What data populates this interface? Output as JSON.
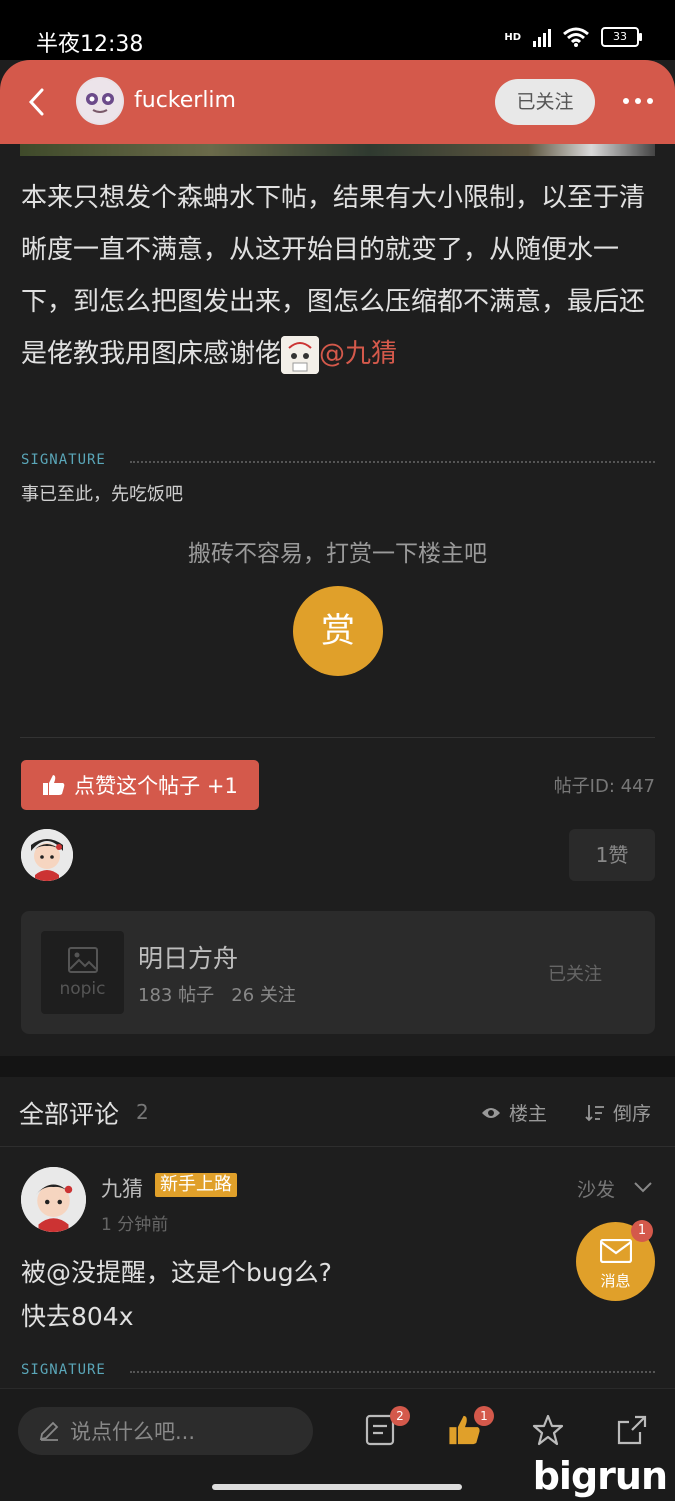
{
  "status_bar": {
    "time": "半夜12:38",
    "network": "HD",
    "battery": "33"
  },
  "header": {
    "username": "fuckerlim",
    "follow_label": "已关注"
  },
  "post": {
    "body_text": "本来只想发个森蚺水下帖，结果有大小限制，以至于清晰度一直不满意，从这开始目的就变了，从随便水一下，到怎么把图发出来，图怎么压缩都不满意，最后还是佬教我用图床感谢佬",
    "mention": "@九猜",
    "signature_label": "SIGNATURE",
    "signature_text": "事已至此，先吃饭吧",
    "tip_prompt": "搬砖不容易，打赏一下楼主吧",
    "tip_button": "赏",
    "like_button": "点赞这个帖子 +1",
    "post_id": "帖子ID: 447",
    "like_count": "1赞"
  },
  "forum": {
    "nopic_label": "nopic",
    "name": "明日方舟",
    "posts": "183 帖子",
    "followers": "26 关注",
    "follow_label": "已关注"
  },
  "comments": {
    "title": "全部评论",
    "count": "2",
    "filter_author": "楼主",
    "filter_order": "倒序",
    "items": [
      {
        "name": "九猜",
        "badge": "新手上路",
        "time": "1 分钟前",
        "floor": "沙发",
        "line1": "被@没提醒，这是个bug么?",
        "line2": "快去804x",
        "signature_label": "SIGNATURE"
      }
    ]
  },
  "floating_message": {
    "label": "消息",
    "badge": "1"
  },
  "bottom_bar": {
    "input_placeholder": "说点什么吧...",
    "comments_badge": "2",
    "likes_badge": "1"
  },
  "watermark": "bigrun",
  "colors": {
    "accent": "#d4594b",
    "gold": "#e0a02a",
    "background": "#1e1e1e"
  }
}
